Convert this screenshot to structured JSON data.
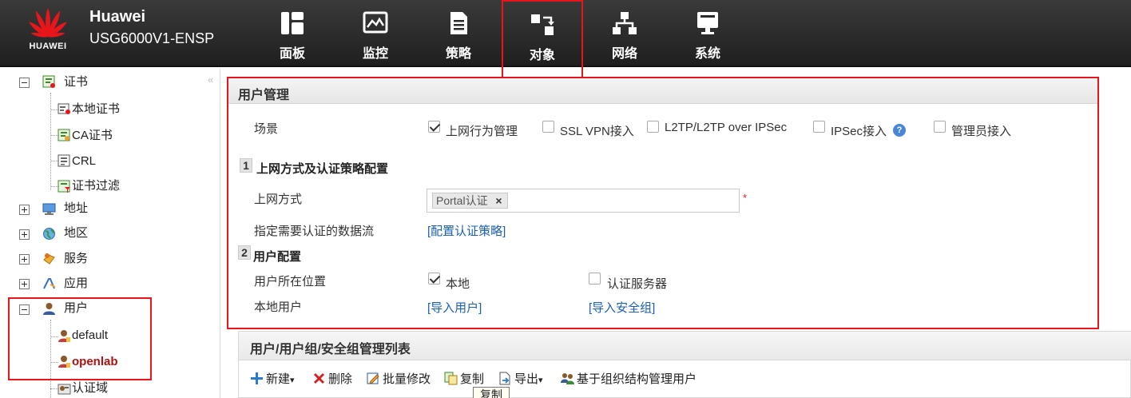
{
  "brand": {
    "logo_text": "HUAWEI",
    "title": "Huawei",
    "model": "USG6000V1-ENSP"
  },
  "nav": [
    {
      "label": "面板",
      "icon": "dashboard-icon"
    },
    {
      "label": "监控",
      "icon": "monitor-icon"
    },
    {
      "label": "策略",
      "icon": "policy-icon"
    },
    {
      "label": "对象",
      "icon": "object-icon",
      "active": true
    },
    {
      "label": "网络",
      "icon": "network-icon"
    },
    {
      "label": "系统",
      "icon": "system-icon"
    }
  ],
  "tree": {
    "collapse_glyph": "«",
    "certificate": "证书",
    "local_cert": "本地证书",
    "ca_cert": "CA证书",
    "crl": "CRL",
    "cert_filter": "证书过滤",
    "address": "地址",
    "region": "地区",
    "service": "服务",
    "application": "应用",
    "user": "用户",
    "user_default": "default",
    "user_openlab": "openlab",
    "auth_domain": "认证域"
  },
  "panel": {
    "title": "用户管理",
    "scene_label": "场景",
    "scenes": [
      {
        "label": "上网行为管理",
        "checked": true
      },
      {
        "label": "SSL VPN接入",
        "checked": false
      },
      {
        "label": "L2TP/L2TP over IPSec",
        "checked": false
      },
      {
        "label": "IPSec接入",
        "checked": false
      },
      {
        "label": "管理员接入",
        "checked": false
      }
    ],
    "help_glyph": "?",
    "step1_num": "1",
    "step1_title": "上网方式及认证策略配置",
    "access_mode_label": "上网方式",
    "access_mode_tag": "Portal认证",
    "tag_remove": "×",
    "required_mark": "*",
    "flow_label": "指定需要认证的数据流",
    "flow_link": "[配置认证策略]",
    "step2_num": "2",
    "step2_title": "用户配置",
    "location_label": "用户所在位置",
    "location_local": "本地",
    "location_server": "认证服务器",
    "local_user_label": "本地用户",
    "import_users": "[导入用户]",
    "import_group": "[导入安全组]"
  },
  "list": {
    "title": "用户/用户组/安全组管理列表",
    "toolbar": {
      "new": "新建",
      "delete": "删除",
      "batch_edit": "批量修改",
      "copy": "复制",
      "export": "导出",
      "org_manage": "基于组织结构管理用户",
      "dropdown_glyph": "▾"
    },
    "tooltip": "复制"
  },
  "colors": {
    "highlight": "#e8161b",
    "link": "#1a5fb4",
    "header_bg": "#2b2b2b"
  }
}
